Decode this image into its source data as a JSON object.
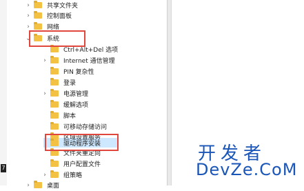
{
  "tree": {
    "items": [
      {
        "label": "共享文件夹",
        "chevron": "›"
      },
      {
        "label": "控制面板",
        "chevron": "›"
      },
      {
        "label": "网络",
        "chevron": "›"
      },
      {
        "label": "系统",
        "chevron": "⌄"
      },
      {
        "label": "Ctrl+Alt+Del 选项",
        "chevron": ""
      },
      {
        "label": "Internet 通信管理",
        "chevron": "›"
      },
      {
        "label": "PIN 复杂性",
        "chevron": ""
      },
      {
        "label": "登录",
        "chevron": ""
      },
      {
        "label": "电源管理",
        "chevron": "›"
      },
      {
        "label": "缓解选项",
        "chevron": ""
      },
      {
        "label": "脚本",
        "chevron": ""
      },
      {
        "label": "可移动存储访问",
        "chevron": ""
      },
      {
        "label": "区域设置服务",
        "chevron": ""
      },
      {
        "label": "驱动程序安装",
        "chevron": ""
      },
      {
        "label": "文件夹重定向",
        "chevron": ""
      },
      {
        "label": "用户配置文件",
        "chevron": ""
      },
      {
        "label": "组策略",
        "chevron": "›"
      },
      {
        "label": "桌面",
        "chevron": "›"
      }
    ]
  },
  "left_strip": {
    "number": "7"
  },
  "watermark": {
    "line1": "开发者",
    "line2": "DevZe.CoM"
  },
  "colors": {
    "highlight": "#e0463c",
    "folder": "#f3c245",
    "watermark": "#1a55b8"
  }
}
